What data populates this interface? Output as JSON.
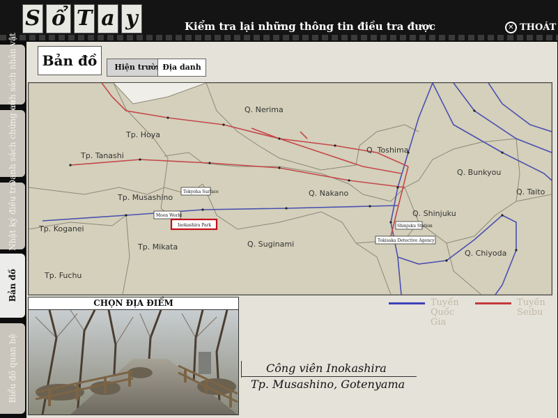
{
  "header": {
    "logo_letters": [
      "S",
      "ổ",
      "T",
      "a",
      "y"
    ],
    "title": "Kiểm tra lại những thông tin điều tra được",
    "exit_label": "THOÁT"
  },
  "side_tabs": [
    {
      "label": "Danh sách nhân vật",
      "active": false
    },
    {
      "label": "Danh sách chứng cứ",
      "active": false
    },
    {
      "label": "Nhật ký điều tra",
      "active": false
    },
    {
      "label": "Bản đồ",
      "active": true
    },
    {
      "label": "Biểu đồ quan hệ",
      "active": false
    }
  ],
  "page_title": "Bản đồ",
  "sub_tabs": [
    {
      "label": "Hiện trường",
      "selected": true
    },
    {
      "label": "Địa danh",
      "selected": false
    }
  ],
  "map": {
    "districts": [
      "Q. Nerima",
      "Tp. Hoya",
      "Tp. Tanashi",
      "Q. Toshima",
      "Q. Bunkyou",
      "Q. Taito",
      "Tp. Musashino",
      "Q. Nakano",
      "Q. Shinjuku",
      "Tp. Koganei",
      "Tp. Mikata",
      "Q. Suginami",
      "Q. Chiyoda",
      "Tp. Fuchu"
    ],
    "place_labels": [
      "Tokyoha Surface",
      "Moon World",
      "Inokashira Park",
      "Shinjuku Station",
      "Tokisaka Detective Agency"
    ],
    "selected_place": "Inokashira Park",
    "colors": {
      "land": "#d4d0bb",
      "national_line": "#4a4fb0",
      "seibu_line": "#c4474a",
      "selected": "#c0101a"
    }
  },
  "legend": [
    {
      "label": "Tuyến Quốc Gia",
      "color": "#3d40b8"
    },
    {
      "label": "Tuyến Seibu",
      "color": "#c23a3a"
    }
  ],
  "location": {
    "header": "CHỌN ĐỊA ĐIỂM",
    "name": "Công viên Inokashira",
    "area": "Tp. Musashino, Gotenyama"
  }
}
